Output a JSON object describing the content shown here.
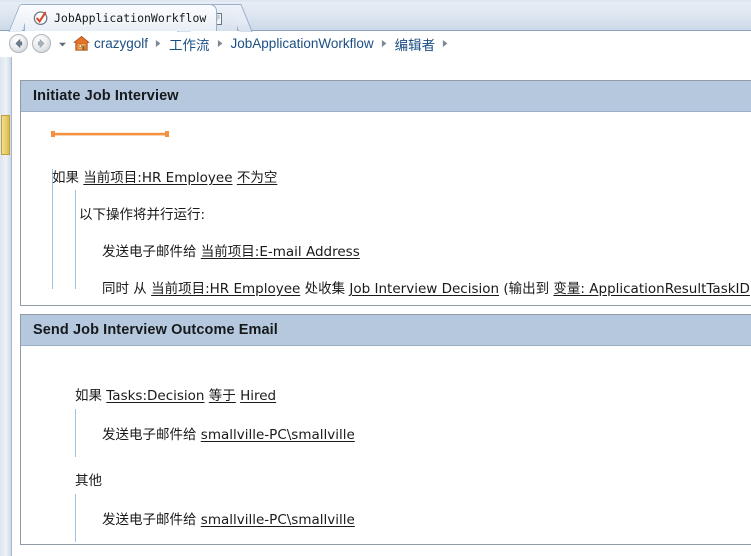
{
  "window": {
    "tabs": [
      {
        "label": "JobApplicationWorkflow",
        "icon": "checkmark-circle-icon",
        "active": true
      },
      {
        "label": "",
        "icon": "new-tab-page-icon",
        "active": false
      }
    ]
  },
  "nav": {
    "back_icon": "arrow-left-icon",
    "forward_icon": "arrow-right-icon",
    "dropdown_icon": "chevron-down-icon",
    "home_icon": "home-icon",
    "breadcrumb": [
      {
        "label": "crazygolf"
      },
      {
        "label": "工作流"
      },
      {
        "label": "JobApplicationWorkflow"
      },
      {
        "label": "编辑者"
      }
    ],
    "separator": "▶"
  },
  "colors": {
    "header_band": "#b6c8de",
    "accent_orange": "#f29140",
    "guide_line": "#9dc3e6",
    "link_text": "#1a1a1a",
    "breadcrumb_text": "#1b4f84",
    "scroll_thumb": "#e9cf6d"
  },
  "cards": [
    {
      "title": "Initiate Job Interview",
      "has_step_bar": true,
      "rows": [
        {
          "id": "condition-row",
          "segments": [
            {
              "text": "如果 ",
              "link": false
            },
            {
              "text": "当前项目:HR Employee",
              "link": true
            },
            {
              "text": " ",
              "link": false
            },
            {
              "text": "不为空",
              "link": true
            }
          ]
        },
        {
          "id": "parallel-label-row",
          "segments": [
            {
              "text": "以下操作将并行运行:",
              "link": false
            }
          ]
        },
        {
          "id": "send-email-row",
          "segments": [
            {
              "text": "发送电子邮件给 ",
              "link": false
            },
            {
              "text": "当前项目:E-mail Address",
              "link": true
            }
          ]
        },
        {
          "id": "collect-data-row",
          "segments": [
            {
              "text": "同时 从 ",
              "link": false
            },
            {
              "text": "当前项目:HR Employee",
              "link": true
            },
            {
              "text": " 处收集 ",
              "link": false
            },
            {
              "text": "Job Interview Decision",
              "link": true
            },
            {
              "text": " (输出到 ",
              "link": false
            },
            {
              "text": "变量: ApplicationResultTaskID",
              "link": true
            },
            {
              "text": " )",
              "link": false
            }
          ]
        }
      ]
    },
    {
      "title": "Send Job Interview Outcome Email",
      "has_step_bar": false,
      "rows": [
        {
          "id": "condition-row",
          "segments": [
            {
              "text": "如果 ",
              "link": false
            },
            {
              "text": "Tasks:Decision",
              "link": true
            },
            {
              "text": " ",
              "link": false
            },
            {
              "text": "等于",
              "link": true
            },
            {
              "text": " ",
              "link": false
            },
            {
              "text": "Hired",
              "link": true
            }
          ]
        },
        {
          "id": "then-email-row",
          "segments": [
            {
              "text": "发送电子邮件给 ",
              "link": false
            },
            {
              "text": "smallville-PC\\smallville",
              "link": true
            }
          ]
        },
        {
          "id": "else-label-row",
          "segments": [
            {
              "text": "其他",
              "link": false
            }
          ]
        },
        {
          "id": "else-email-row",
          "segments": [
            {
              "text": "发送电子邮件给 ",
              "link": false
            },
            {
              "text": "smallville-PC\\smallville",
              "link": true
            }
          ]
        }
      ]
    }
  ]
}
